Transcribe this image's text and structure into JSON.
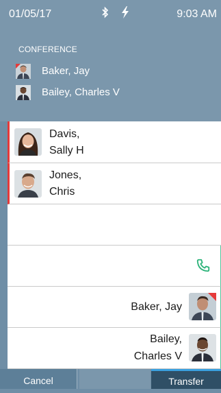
{
  "status": {
    "date": "01/05/17",
    "time": "9:03 AM"
  },
  "conference": {
    "title": "CONFERENCE",
    "members": [
      {
        "name": "Baker, Jay"
      },
      {
        "name": "Bailey, Charles V"
      }
    ]
  },
  "held_calls": [
    {
      "line1": "Davis,",
      "line2": "Sally H"
    },
    {
      "line1": "Jones,",
      "line2": "Chris"
    }
  ],
  "transfer_targets": [
    {
      "name": "Baker, Jay"
    },
    {
      "line1": "Bailey,",
      "line2": "Charles V"
    }
  ],
  "buttons": {
    "cancel": "Cancel",
    "middle": "",
    "transfer": "Transfer"
  },
  "colors": {
    "hold_red": "#e53a3a",
    "phone_green": "#2db37a",
    "transfer_blue": "#3aa0e0"
  }
}
